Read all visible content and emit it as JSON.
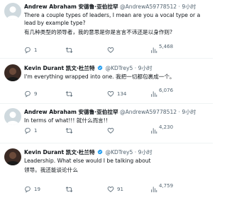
{
  "tweets": [
    {
      "name": "Andrew Abraham 安德鲁·亚伯拉罕",
      "handle": "@AndrewA59778512",
      "time": "9小时",
      "text": "There a couple types of leaders, I mean are you a vocal type or a lead by example type?",
      "translation": "有几种类型的领导者，我的意思是你是言言不讳还是以身作则?",
      "replies": "1",
      "retweets": "",
      "likes": "",
      "views": "5,468"
    },
    {
      "name": "Kevin Durant 凯文·杜兰特",
      "handle": "@KDTrey5",
      "time": "9小时",
      "text": "I'm everything wrapped into one. 我把一切都包裹成一个。",
      "translation": "",
      "replies": "9",
      "retweets": "",
      "likes": "134",
      "views": "6,076"
    },
    {
      "name": "Andrew Abraham 安德鲁·亚伯拉罕",
      "handle": "@AndrewA59778512",
      "time": "9小时",
      "text": "In terms of what!!! 就什么而言!!",
      "translation": "",
      "replies": "1",
      "retweets": "",
      "likes": "",
      "views": "4,230"
    },
    {
      "name": "Kevin Durant 凯文·杜兰特",
      "handle": "@KDTrey5",
      "time": "9小时",
      "text": "Leadership. What else would I be talking about",
      "translation": "领导。我还能谈论什么",
      "replies": "19",
      "retweets": "",
      "likes": "91",
      "views": "4,759"
    }
  ],
  "colors": {
    "text": "#0f1419",
    "secondary": "#536471",
    "verified": "#1d9bf0",
    "divider": "#eff3f4"
  },
  "icons": [
    "reply-icon",
    "retweet-icon",
    "like-icon",
    "views-icon",
    "bookmark-icon",
    "share-icon",
    "verified-badge-icon"
  ]
}
